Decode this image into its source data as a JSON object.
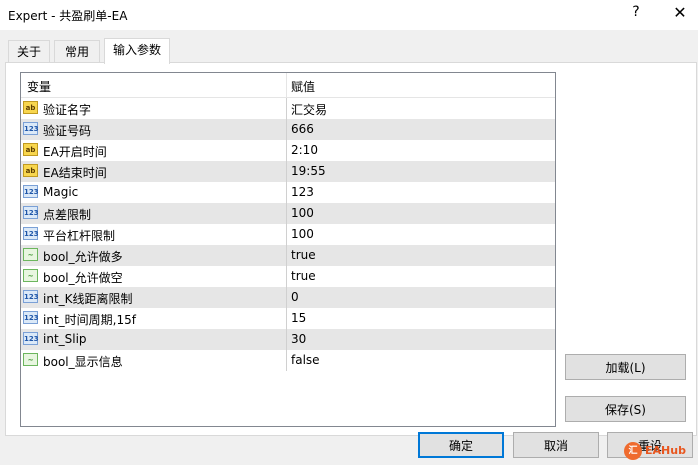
{
  "window": {
    "title": "Expert - 共盈刷单-EA",
    "help_label": "?",
    "close_label": "✕"
  },
  "tabs": [
    {
      "label": "关于"
    },
    {
      "label": "常用"
    },
    {
      "label": "输入参数"
    }
  ],
  "grid": {
    "columns": [
      "变量",
      "赋值"
    ],
    "rows": [
      {
        "type": "ab",
        "icon": "ab",
        "name": "验证名字",
        "value": "汇交易"
      },
      {
        "type": "123",
        "icon": "123",
        "name": "验证号码",
        "value": "666"
      },
      {
        "type": "ab",
        "icon": "ab",
        "name": "EA开启时间",
        "value": "2:10"
      },
      {
        "type": "ab",
        "icon": "ab",
        "name": "EA结束时间",
        "value": "19:55"
      },
      {
        "type": "123",
        "icon": "123",
        "name": "Magic",
        "value": "123"
      },
      {
        "type": "123",
        "icon": "123",
        "name": "点差限制",
        "value": "100"
      },
      {
        "type": "123",
        "icon": "123",
        "name": "平台杠杆限制",
        "value": "100"
      },
      {
        "type": "bool",
        "icon": "~",
        "name": "bool_允许做多",
        "value": "true"
      },
      {
        "type": "bool",
        "icon": "~",
        "name": "bool_允许做空",
        "value": "true"
      },
      {
        "type": "123",
        "icon": "123",
        "name": "int_K线距离限制",
        "value": "0"
      },
      {
        "type": "123",
        "icon": "123",
        "name": "int_时间周期,15f",
        "value": "15"
      },
      {
        "type": "123",
        "icon": "123",
        "name": "int_Slip",
        "value": "30"
      },
      {
        "type": "bool",
        "icon": "~",
        "name": "bool_显示信息",
        "value": "false"
      }
    ]
  },
  "buttons": {
    "load": "加载(L)",
    "save": "保存(S)",
    "ok": "确定",
    "cancel": "取消",
    "reset": "重设"
  },
  "watermark": {
    "logo": "汇",
    "text": "EAHub"
  }
}
